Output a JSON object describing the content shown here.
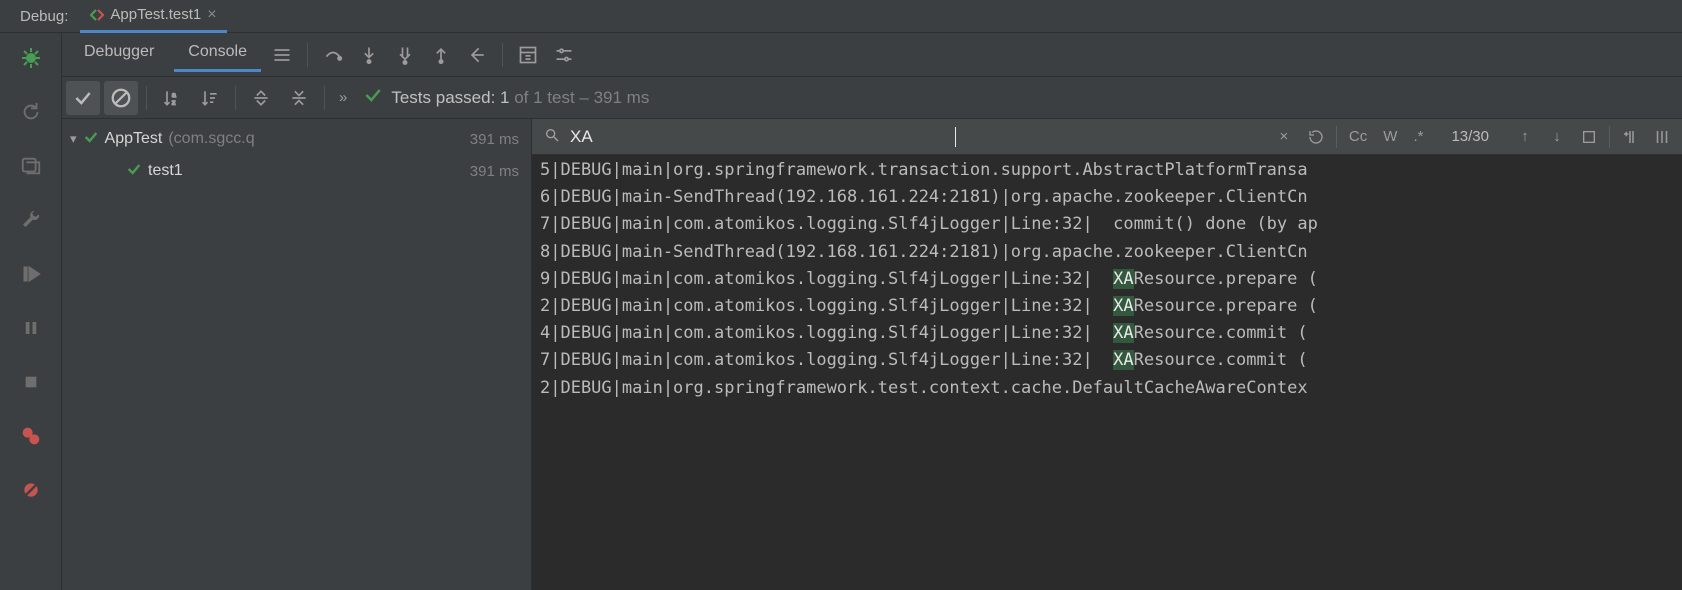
{
  "header": {
    "debug_label": "Debug:",
    "tab_name": "AppTest.test1"
  },
  "subtabs": {
    "debugger": "Debugger",
    "console": "Console"
  },
  "status": {
    "prefix": "Tests passed: ",
    "passed": "1",
    "mid": " of 1 test – ",
    "duration": "391 ms"
  },
  "tree": {
    "root_name": "AppTest",
    "root_qual": "(com.sgcc.q",
    "root_time": "391 ms",
    "child_name": "test1",
    "child_time": "391 ms"
  },
  "search": {
    "value": "XA",
    "cc": "Cc",
    "w": "W",
    "regex": ".*",
    "count": "13/30"
  },
  "log": {
    "lines": [
      {
        "n": "5",
        "text": "|DEBUG|main|org.springframework.transaction.support.AbstractPlatformTransa"
      },
      {
        "n": "6",
        "text": "|DEBUG|main-SendThread(192.168.161.224:2181)|org.apache.zookeeper.ClientCn"
      },
      {
        "n": "7",
        "text": "|DEBUG|main|com.atomikos.logging.Slf4jLogger|Line:32|  commit() done (by ap"
      },
      {
        "n": "8",
        "text": "|DEBUG|main-SendThread(192.168.161.224:2181)|org.apache.zookeeper.ClientCn"
      },
      {
        "n": "9",
        "text": "|DEBUG|main|com.atomikos.logging.Slf4jLogger|Line:32|  ",
        "hl": "XA",
        "after": "Resource.prepare ("
      },
      {
        "n": "2",
        "text": "|DEBUG|main|com.atomikos.logging.Slf4jLogger|Line:32|  ",
        "hl": "XA",
        "after": "Resource.prepare ("
      },
      {
        "n": "4",
        "text": "|DEBUG|main|com.atomikos.logging.Slf4jLogger|Line:32|  ",
        "hl": "XA",
        "after": "Resource.commit ( "
      },
      {
        "n": "7",
        "text": "|DEBUG|main|com.atomikos.logging.Slf4jLogger|Line:32|  ",
        "hl": "XA",
        "after": "Resource.commit ( "
      },
      {
        "n": "2",
        "text": "|DEBUG|main|org.springframework.test.context.cache.DefaultCacheAwareContex"
      }
    ]
  }
}
